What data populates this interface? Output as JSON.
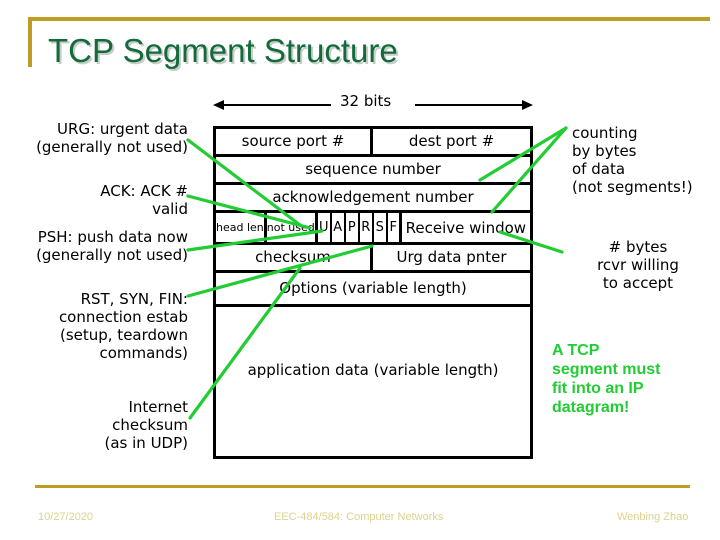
{
  "slide": {
    "title": "TCP Segment Structure",
    "accent_gold": "#bf9d22",
    "title_color": "#136b3c",
    "connector_color": "#22cc33"
  },
  "width_label": "32 bits",
  "left_notes": [
    {
      "id": "urg",
      "text": "URG: urgent data\n(generally not used)"
    },
    {
      "id": "ack",
      "text": "ACK: ACK #\nvalid"
    },
    {
      "id": "psh",
      "text": "PSH: push data now\n(generally not used)"
    },
    {
      "id": "rsf",
      "text": "RST, SYN, FIN:\nconnection estab\n(setup, teardown\ncommands)"
    },
    {
      "id": "cksum",
      "text": "Internet\nchecksum\n(as in UDP)"
    }
  ],
  "right_notes": [
    {
      "id": "counting",
      "text": "counting\nby bytes\nof data\n(not segments!)"
    },
    {
      "id": "rwnd",
      "text": "# bytes\nrcvr willing\nto accept"
    }
  ],
  "callout": {
    "text": "A TCP\nsegment must\nfit into an IP\ndatagram!",
    "color": "#22cc33"
  },
  "header_table": {
    "rows": [
      {
        "id": "ports",
        "cells": [
          {
            "label": "source port #"
          },
          {
            "label": "dest port #"
          }
        ]
      },
      {
        "id": "seq",
        "cells": [
          {
            "label": "sequence number"
          }
        ]
      },
      {
        "id": "ack",
        "cells": [
          {
            "label": "acknowledgement number"
          }
        ]
      },
      {
        "id": "flags",
        "cells": [
          {
            "label": "head\nlen"
          },
          {
            "label": "not\nused"
          },
          {
            "label": "U"
          },
          {
            "label": "A"
          },
          {
            "label": "P"
          },
          {
            "label": "R"
          },
          {
            "label": "S"
          },
          {
            "label": "F"
          },
          {
            "label": "Receive window"
          }
        ]
      },
      {
        "id": "cksum",
        "cells": [
          {
            "label": "checksum"
          },
          {
            "label": "Urg data pnter"
          }
        ]
      },
      {
        "id": "options",
        "cells": [
          {
            "label": "Options (variable length)"
          }
        ]
      },
      {
        "id": "appdata",
        "cells": [
          {
            "label": "application\ndata\n(variable length)"
          }
        ]
      }
    ]
  },
  "footer": {
    "date": "10/27/2020",
    "course": "EEC-484/584: Computer Networks",
    "author": "Wenbing Zhao",
    "color": "#ddd28a"
  }
}
